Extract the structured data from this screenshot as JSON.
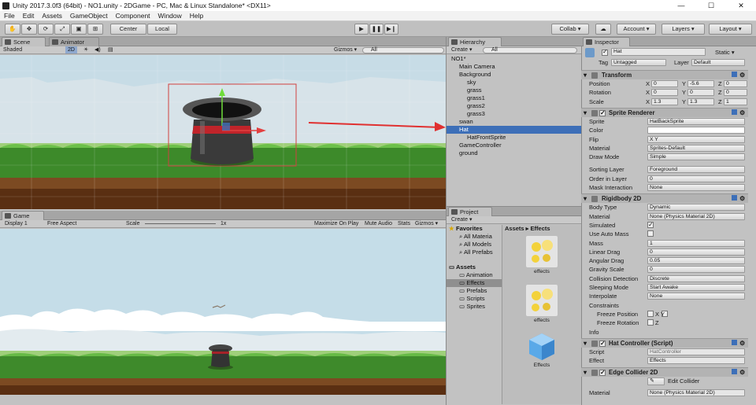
{
  "window": {
    "title": "Unity 2017.3.0f3 (64bit) - NO1.unity - 2DGame - PC, Mac & Linux Standalone* <DX11>",
    "controls": [
      "—",
      "☐",
      "✕"
    ]
  },
  "menu": [
    "File",
    "Edit",
    "Assets",
    "GameObject",
    "Component",
    "Window",
    "Help"
  ],
  "toolbar": {
    "center": "Center",
    "local": "Local",
    "collab": "Collab ▾",
    "account": "Account ▾",
    "layers": "Layers ▾",
    "layout": "Layout ▾"
  },
  "scene": {
    "tab": "Scene",
    "animator_tab": "Animator",
    "shaded": "Shaded",
    "mode2d": "2D",
    "gizmos": "Gizmos ▾",
    "search": "All"
  },
  "game": {
    "tab": "Game",
    "display": "Display 1",
    "aspect": "Free Aspect",
    "scale_label": "Scale",
    "scale_value": "1x",
    "maximize": "Maximize On Play",
    "mute": "Mute Audio",
    "stats": "Stats",
    "gizmos": "Gizmos ▾"
  },
  "hierarchy": {
    "tab": "Hierarchy",
    "create": "Create ▾",
    "search": "All",
    "items": [
      {
        "label": "NO1*",
        "indent": 0
      },
      {
        "label": "Main Camera",
        "indent": 1
      },
      {
        "label": "Background",
        "indent": 1
      },
      {
        "label": "sky",
        "indent": 2
      },
      {
        "label": "grass",
        "indent": 2
      },
      {
        "label": "grass1",
        "indent": 2
      },
      {
        "label": "grass2",
        "indent": 2
      },
      {
        "label": "grass3",
        "indent": 2
      },
      {
        "label": "swan",
        "indent": 1
      },
      {
        "label": "Hat",
        "indent": 1,
        "selected": true
      },
      {
        "label": "HatFrontSprite",
        "indent": 2
      },
      {
        "label": "GameController",
        "indent": 1
      },
      {
        "label": "ground",
        "indent": 1
      }
    ]
  },
  "project": {
    "tab": "Project",
    "create": "Create ▾",
    "favorites": "Favorites",
    "fav_items": [
      "All Materia",
      "All Models",
      "All Prefabs"
    ],
    "assets": "Assets",
    "asset_items": [
      "Animation",
      "Effects",
      "Prefabs",
      "Scripts",
      "Sprites"
    ],
    "breadcrumb": "Assets ▸ Effects",
    "files": [
      "effects",
      "effects",
      "Effects"
    ]
  },
  "inspector": {
    "tab": "Inspector",
    "name": "Hat",
    "static": "Static ▾",
    "tag_label": "Tag",
    "tag": "Untagged",
    "layer_label": "Layer",
    "layer": "Default",
    "transform": {
      "title": "Transform",
      "rows": [
        {
          "label": "Position",
          "x": "0",
          "y": "-5.6",
          "z": "0"
        },
        {
          "label": "Rotation",
          "x": "0",
          "y": "0",
          "z": "0"
        },
        {
          "label": "Scale",
          "x": "1.3",
          "y": "1.3",
          "z": "1"
        }
      ]
    },
    "sprite_renderer": {
      "title": "Sprite Renderer",
      "rows": [
        {
          "label": "Sprite",
          "value": "HatBackSprite"
        },
        {
          "label": "Color",
          "value": ""
        },
        {
          "label": "Flip",
          "value": "X  Y"
        },
        {
          "label": "Material",
          "value": "Sprites-Default"
        },
        {
          "label": "Draw Mode",
          "value": "Simple"
        },
        {
          "label": "Sorting Layer",
          "value": "Foreground"
        },
        {
          "label": "Order in Layer",
          "value": "0"
        },
        {
          "label": "Mask Interaction",
          "value": "None"
        }
      ]
    },
    "rigidbody": {
      "title": "Rigidbody 2D",
      "rows": [
        {
          "label": "Body Type",
          "value": "Dynamic"
        },
        {
          "label": "Material",
          "value": "None (Physics Material 2D)"
        },
        {
          "label": "Simulated",
          "value": "✓"
        },
        {
          "label": "Use Auto Mass",
          "value": ""
        },
        {
          "label": "Mass",
          "value": "1"
        },
        {
          "label": "Linear Drag",
          "value": "0"
        },
        {
          "label": "Angular Drag",
          "value": "0.05"
        },
        {
          "label": "Gravity Scale",
          "value": "0"
        },
        {
          "label": "Collision Detection",
          "value": "Discrete"
        },
        {
          "label": "Sleeping Mode",
          "value": "Start Awake"
        },
        {
          "label": "Interpolate",
          "value": "None"
        }
      ],
      "constraints": "Constraints",
      "freeze_pos": "Freeze Position",
      "freeze_rot": "Freeze Rotation",
      "xy": "X  Y",
      "z": "Z",
      "info": "Info"
    },
    "hat_controller": {
      "title": "Hat Controller (Script)",
      "script_label": "Script",
      "script": "HatController",
      "effect_label": "Effect",
      "effect": "Effects"
    },
    "edge_collider": {
      "title": "Edge Collider 2D",
      "edit": "Edit Collider",
      "material_label": "Material",
      "material": "None (Physics Material 2D)"
    }
  },
  "colors": {
    "selection": "#3d6fb8",
    "arrow": "#e03030",
    "grass": "#3d8a2a",
    "ground": "#6b3a1a"
  }
}
